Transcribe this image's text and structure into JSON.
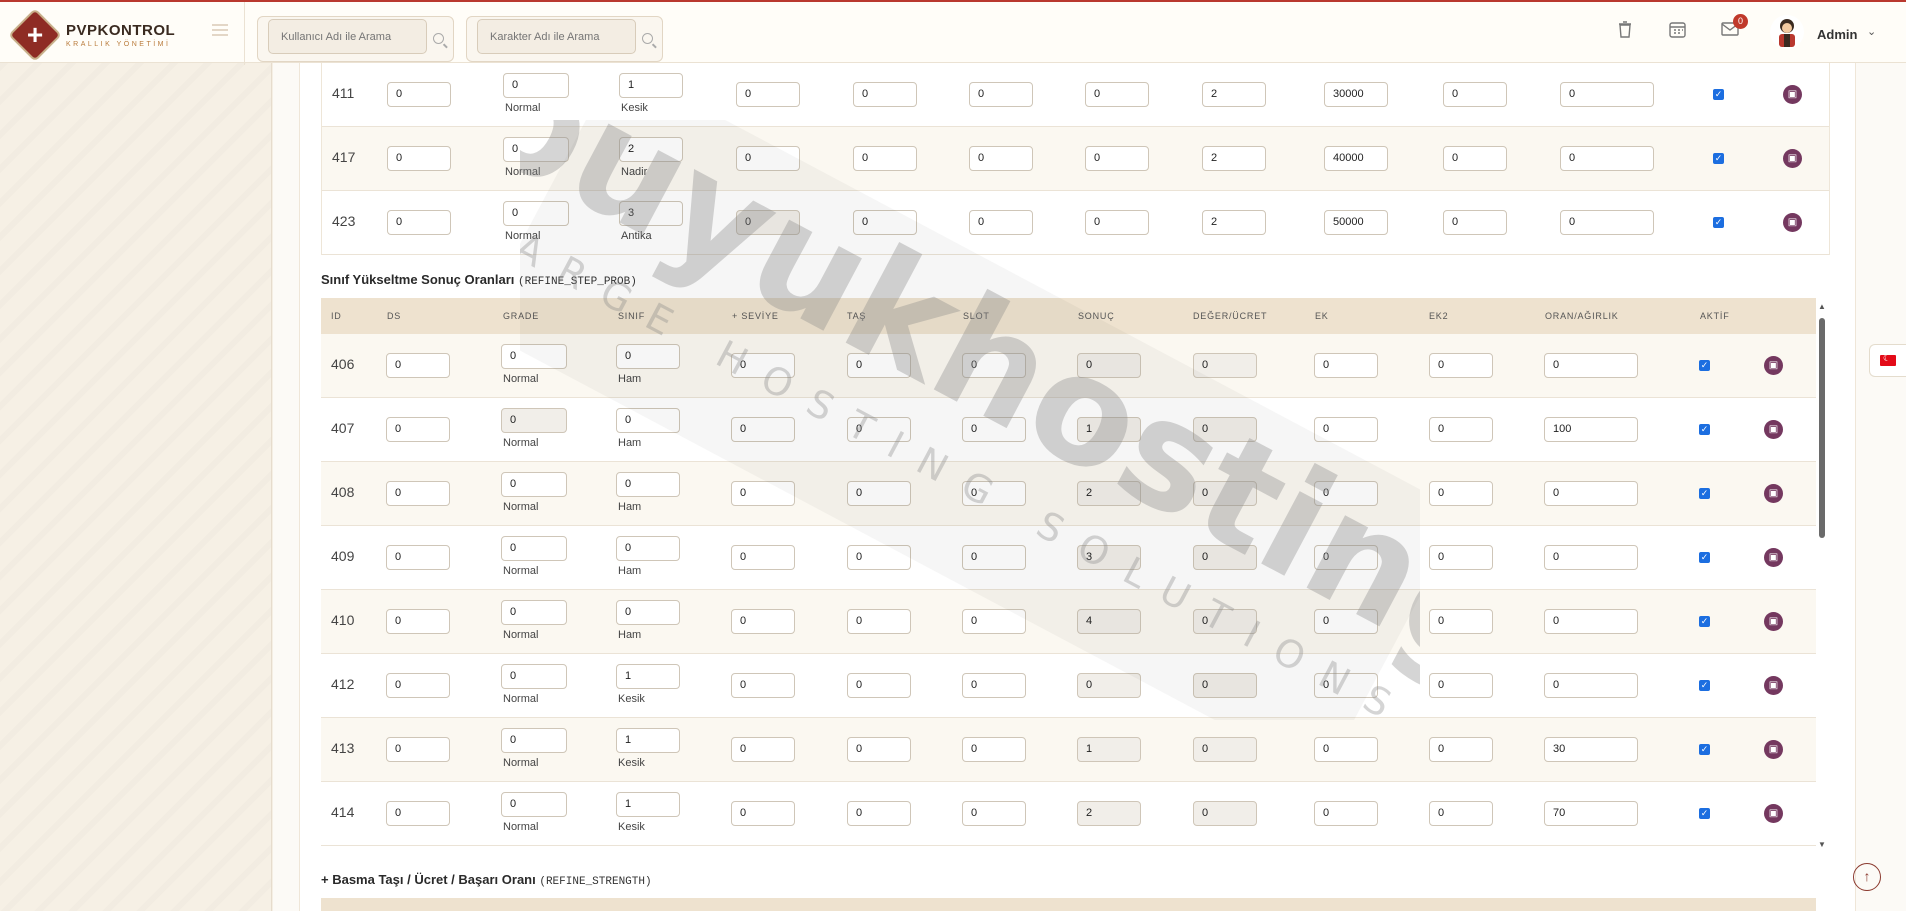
{
  "brand": {
    "title": "PVPKONTROL",
    "subtitle": "KRALLIK YÖNETİMİ"
  },
  "search": {
    "user_placeholder": "Kullanıcı Adı ile Arama",
    "char_placeholder": "Karakter Adı ile Arama"
  },
  "header": {
    "notification_count": "0",
    "admin_name": "Admin"
  },
  "table_top": {
    "rows": [
      {
        "id": "411",
        "v1": "0",
        "grade": "0",
        "grade_label": "Normal",
        "class": "1",
        "class_label": "Kesik",
        "v4": "0",
        "v5": "0",
        "v6": "0",
        "v7": "0",
        "v8": "2",
        "v9": "30000",
        "v10": "0",
        "v11": "0",
        "active": true
      },
      {
        "id": "417",
        "v1": "0",
        "grade": "0",
        "grade_label": "Normal",
        "class": "2",
        "class_label": "Nadir",
        "v4": "0",
        "v5": "0",
        "v6": "0",
        "v7": "0",
        "v8": "2",
        "v9": "40000",
        "v10": "0",
        "v11": "0",
        "active": true
      },
      {
        "id": "423",
        "v1": "0",
        "grade": "0",
        "grade_label": "Normal",
        "class": "3",
        "class_label": "Antika",
        "v4": "0",
        "v5": "0",
        "v6": "0",
        "v7": "0",
        "v8": "2",
        "v9": "50000",
        "v10": "0",
        "v11": "0",
        "active": true
      }
    ]
  },
  "section2": {
    "title": "Sınıf Yükseltme Sonuç Oranları",
    "code": "(REFINE_STEP_PROB)",
    "headers": [
      "ID",
      "DS",
      "GRADE",
      "SINIF",
      "+ SEVİYE",
      "TAŞ",
      "SLOT",
      "SONUÇ",
      "DEĞER/ÜCRET",
      "EK",
      "EK2",
      "ORAN/AĞIRLIK",
      "AKTİF"
    ],
    "rows": [
      {
        "id": "406",
        "ds": "0",
        "grade": "0",
        "grade_label": "Normal",
        "class": "0",
        "class_label": "Ham",
        "level": "0",
        "stone": "0",
        "slot": "0",
        "result": "0",
        "value": "0",
        "ek": "0",
        "ek2": "0",
        "ratio": "0",
        "active": true
      },
      {
        "id": "407",
        "ds": "0",
        "grade": "0",
        "grade_label": "Normal",
        "class": "0",
        "class_label": "Ham",
        "level": "0",
        "stone": "0",
        "slot": "0",
        "result": "1",
        "value": "0",
        "ek": "0",
        "ek2": "0",
        "ratio": "100",
        "active": true
      },
      {
        "id": "408",
        "ds": "0",
        "grade": "0",
        "grade_label": "Normal",
        "class": "0",
        "class_label": "Ham",
        "level": "0",
        "stone": "0",
        "slot": "0",
        "result": "2",
        "value": "0",
        "ek": "0",
        "ek2": "0",
        "ratio": "0",
        "active": true
      },
      {
        "id": "409",
        "ds": "0",
        "grade": "0",
        "grade_label": "Normal",
        "class": "0",
        "class_label": "Ham",
        "level": "0",
        "stone": "0",
        "slot": "0",
        "result": "3",
        "value": "0",
        "ek": "0",
        "ek2": "0",
        "ratio": "0",
        "active": true
      },
      {
        "id": "410",
        "ds": "0",
        "grade": "0",
        "grade_label": "Normal",
        "class": "0",
        "class_label": "Ham",
        "level": "0",
        "stone": "0",
        "slot": "0",
        "result": "4",
        "value": "0",
        "ek": "0",
        "ek2": "0",
        "ratio": "0",
        "active": true
      },
      {
        "id": "412",
        "ds": "0",
        "grade": "0",
        "grade_label": "Normal",
        "class": "1",
        "class_label": "Kesik",
        "level": "0",
        "stone": "0",
        "slot": "0",
        "result": "0",
        "value": "0",
        "ek": "0",
        "ek2": "0",
        "ratio": "0",
        "active": true
      },
      {
        "id": "413",
        "ds": "0",
        "grade": "0",
        "grade_label": "Normal",
        "class": "1",
        "class_label": "Kesik",
        "level": "0",
        "stone": "0",
        "slot": "0",
        "result": "1",
        "value": "0",
        "ek": "0",
        "ek2": "0",
        "ratio": "30",
        "active": true
      },
      {
        "id": "414",
        "ds": "0",
        "grade": "0",
        "grade_label": "Normal",
        "class": "1",
        "class_label": "Kesik",
        "level": "0",
        "stone": "0",
        "slot": "0",
        "result": "2",
        "value": "0",
        "ek": "0",
        "ek2": "0",
        "ratio": "70",
        "active": true
      }
    ]
  },
  "section3": {
    "title": "+ Basma Taşı / Ücret / Başarı Oranı",
    "code": "(REFINE_STRENGTH)"
  },
  "watermark": {
    "brand": "buyukhosting",
    "tagline": "LARGE HOSTING SOLUTIONS"
  },
  "colors": {
    "accent": "#8e2c24",
    "save_button": "#74385f",
    "header_bg": "#eee2cf",
    "checkbox": "#1c6ee0"
  },
  "icons": [
    "trash-icon",
    "calendar-icon",
    "mail-icon",
    "chevron-down-icon",
    "search-icon",
    "save-icon",
    "arrow-up-icon",
    "flag-tr-icon"
  ]
}
